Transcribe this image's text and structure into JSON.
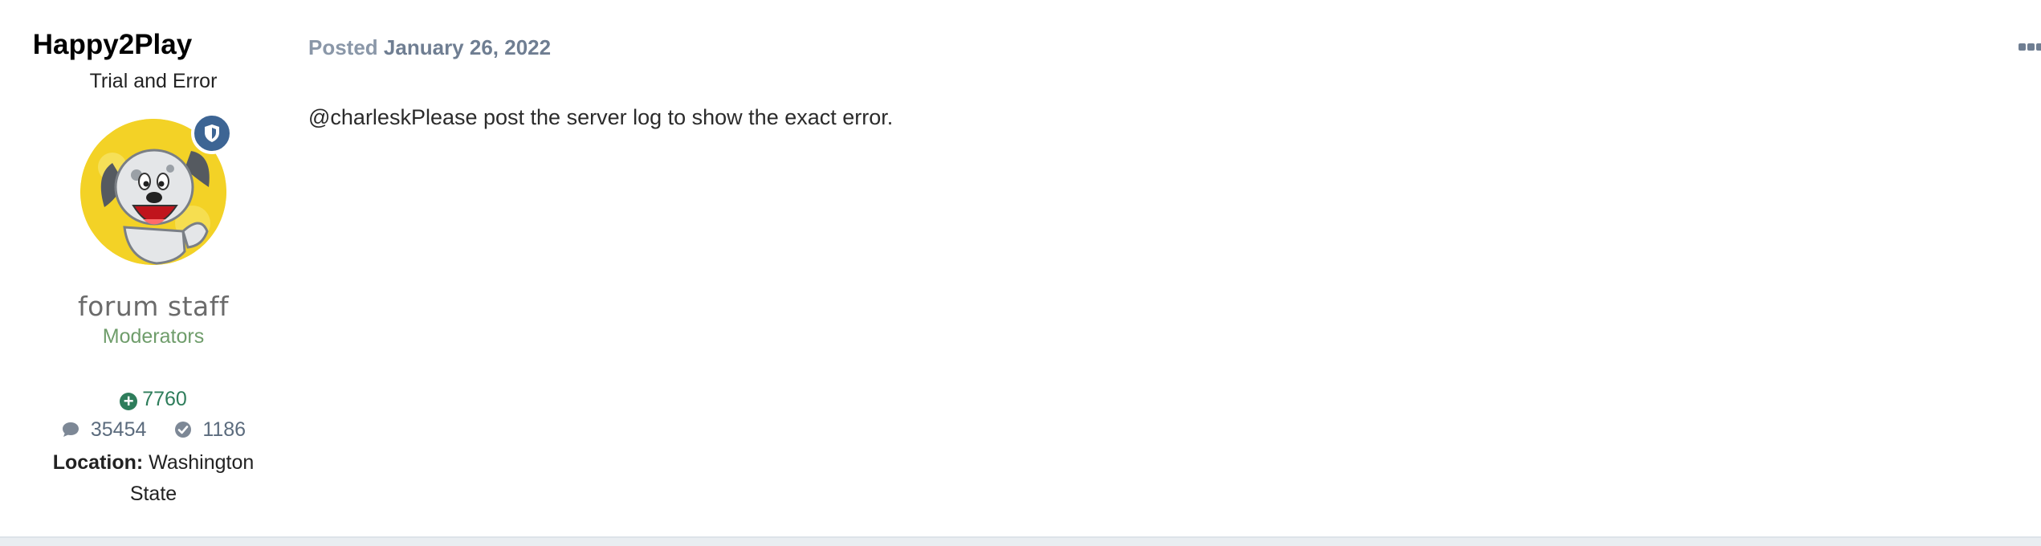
{
  "author": {
    "name": "Happy2Play",
    "title": "Trial and Error",
    "group_image_text": "forum staff",
    "group_name": "Moderators",
    "reputation": "7760",
    "post_count": "35454",
    "solutions": "1186",
    "location_label": "Location:",
    "location_value": "Washington State"
  },
  "post": {
    "posted_label": "Posted",
    "date": "January 26, 2022",
    "body": "@charleskPlease post the server log to show the exact error."
  },
  "icons": {
    "badge": "shield-icon",
    "reputation": "plus-circle-icon",
    "posts": "comment-icon",
    "solutions": "check-circle-icon",
    "menu": "ellipsis-icon"
  },
  "colors": {
    "author_name": "#000000",
    "group_name": "#6f9d6b",
    "reputation": "#2e7d5b",
    "meta": "#6f7e92",
    "badge": "#3d6594"
  }
}
